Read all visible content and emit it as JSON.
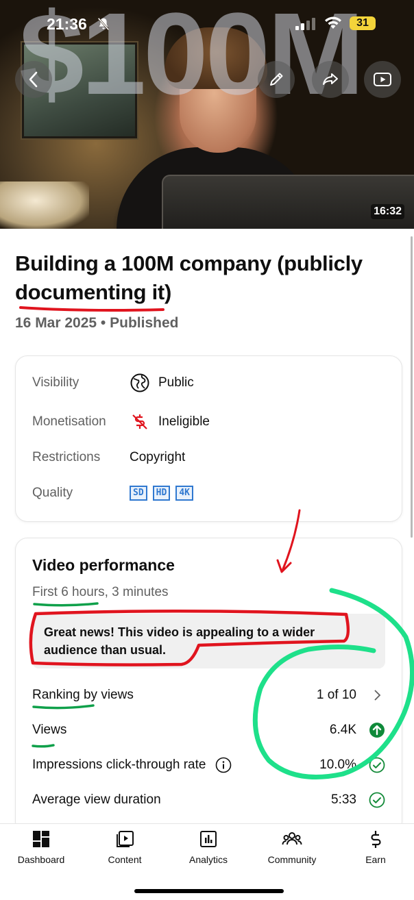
{
  "status_bar": {
    "time": "21:36",
    "battery": "31"
  },
  "thumbnail": {
    "overlay_text": "$100M",
    "duration": "16:32"
  },
  "video": {
    "title": "Building a 100M company (publicly documenting it)",
    "date_status": "16 Mar 2025 • Published"
  },
  "details": {
    "visibility_label": "Visibility",
    "visibility_value": "Public",
    "monetisation_label": "Monetisation",
    "monetisation_value": "Ineligible",
    "restrictions_label": "Restrictions",
    "restrictions_value": "Copyright",
    "quality_label": "Quality",
    "quality_badges": [
      "SD",
      "HD",
      "4K"
    ]
  },
  "performance": {
    "title": "Video performance",
    "period": "First 6 hours, 3 minutes",
    "news": "Great news! This video is appealing to a wider audience than usual.",
    "rows": [
      {
        "label": "Ranking by views",
        "value": "1 of 10"
      },
      {
        "label": "Views",
        "value": "6.4K"
      },
      {
        "label": "Impressions click-through rate",
        "value": "10.0%"
      },
      {
        "label": "Average view duration",
        "value": "5:33"
      }
    ]
  },
  "nav": {
    "items": [
      "Dashboard",
      "Content",
      "Analytics",
      "Community",
      "Earn"
    ]
  },
  "colors": {
    "accent_green": "#0f8a3a",
    "check_green": "#128a38",
    "quality_blue": "#2f78d0",
    "annotation_red": "#e0141e",
    "annotation_green": "#1ee08a"
  }
}
